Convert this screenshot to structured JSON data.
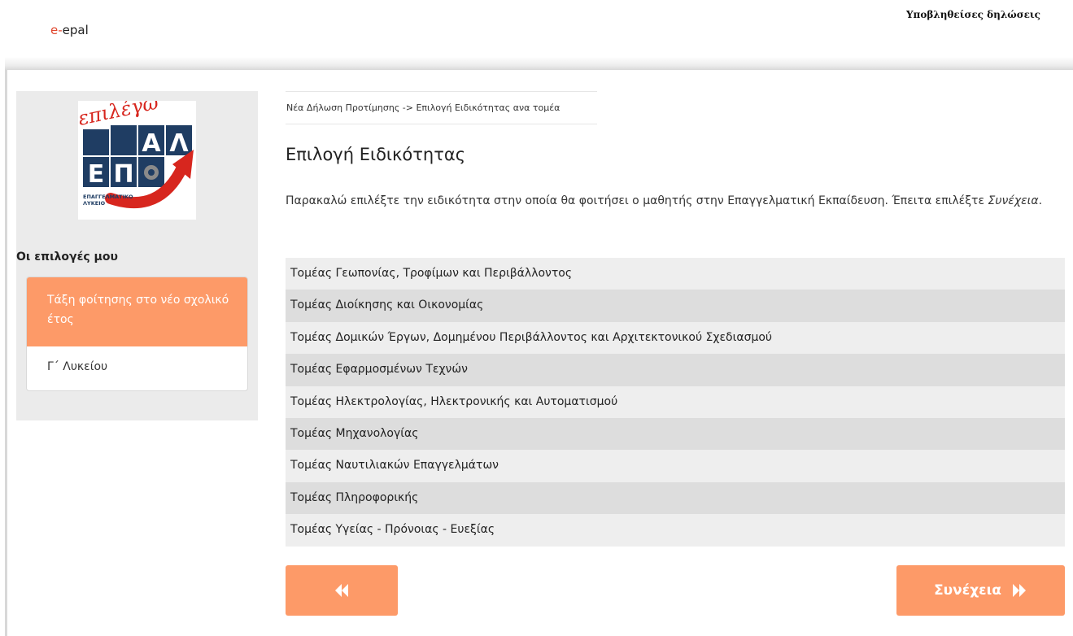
{
  "header": {
    "brand_prefix": "e-",
    "brand_name": "epal",
    "submitted_link": "Υποβληθείσες δηλώσεις"
  },
  "sidebar": {
    "logo": {
      "script_text": "επιλέγω",
      "letters": "ΕΠΑΛ",
      "caption_line1": "ΕΠΑΓΓΕΛΜΑΤΙΚΟ",
      "caption_line2": "ΛΥΚΕΙΟ"
    },
    "heading": "Οι επιλογές μου",
    "choice": {
      "label": "Τάξη φοίτησης στο νέο σχολικό έτος",
      "value": "Γ΄ Λυκείου"
    }
  },
  "main": {
    "breadcrumb": "Νέα Δήλωση Προτίμησης -> Επιλογή Ειδικότητας ανα τομέα",
    "title": "Επιλογή Ειδικότητας",
    "instructions_text": "Παρακαλώ επιλέξτε την ειδικότητα στην οποία θα φοιτήσει ο μαθητής στην Επαγγελματική Εκπαίδευση. Έπειτα επιλέξτε ",
    "instructions_emphasis": "Συνέχεια",
    "instructions_end": ".",
    "sectors": [
      "Τομέας Γεωπονίας, Τροφίμων και Περιβάλλοντος",
      "Τομέας Διοίκησης και Οικονομίας",
      "Τομέας Δομικών Έργων, Δομημένου Περιβάλλοντος και Αρχιτεκτονικού Σχεδιασμού",
      "Τομέας Εφαρμοσμένων Τεχνών",
      "Τομέας Ηλεκτρολογίας, Ηλεκτρονικής και Αυτοματισμού",
      "Τομέας Μηχανολογίας",
      "Τομέας Ναυτιλιακών Επαγγελμάτων",
      "Τομέας Πληροφορικής",
      "Τομέας Υγείας - Πρόνοιας - Ευεξίας"
    ],
    "back_icon": "double-chevron-left-icon",
    "next_label": "Συνέχεια",
    "next_icon": "double-chevron-right-icon"
  },
  "colors": {
    "accent": "#fd9a68",
    "sidebar_bg": "#ebebeb",
    "row_light": "#eeeeee",
    "row_dark": "#dddddd",
    "brand_red": "#e0462d"
  }
}
